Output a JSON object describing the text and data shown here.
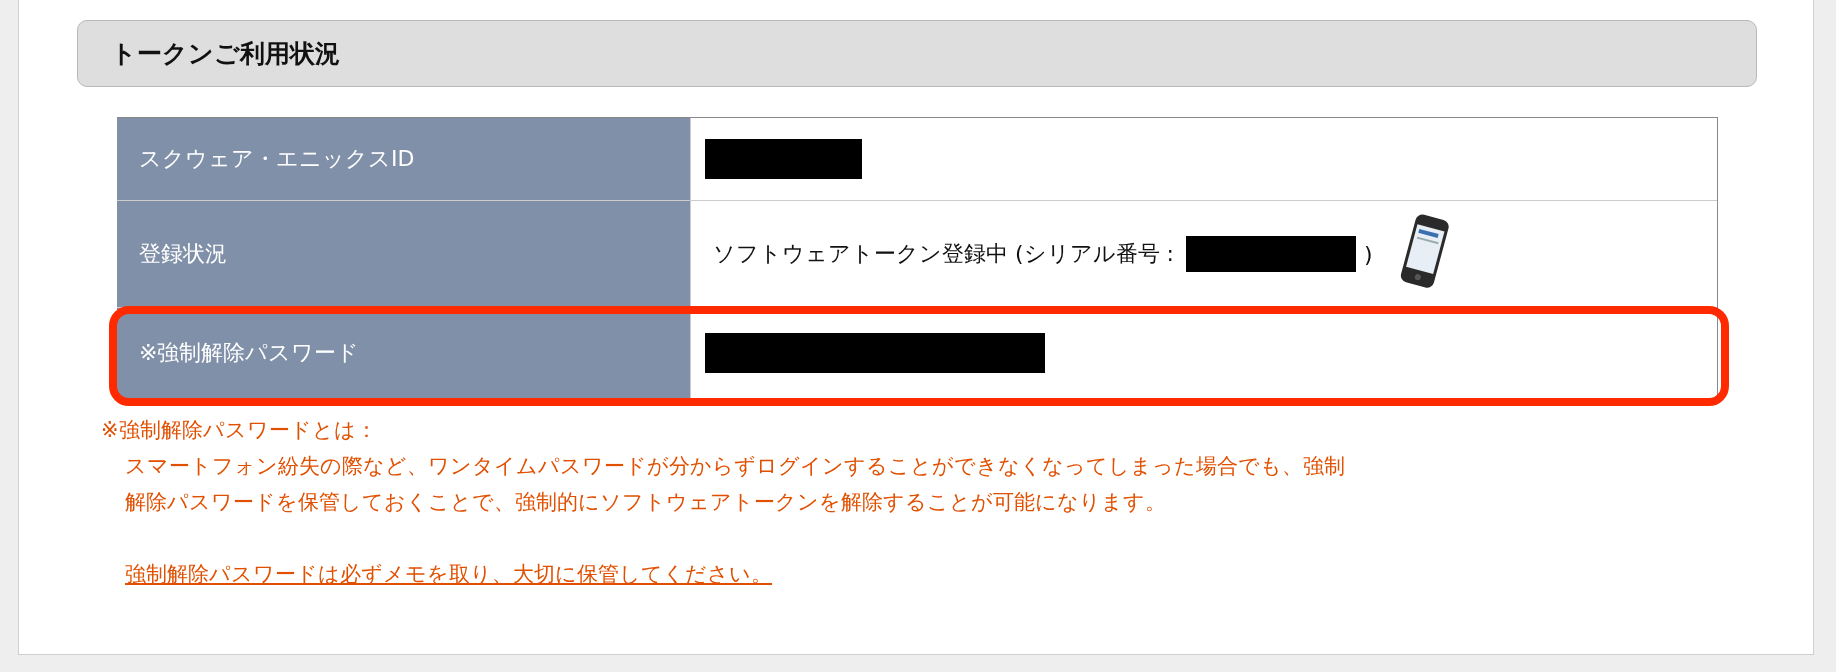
{
  "section": {
    "title": "トークンご利用状況"
  },
  "rows": [
    {
      "label": "スクウェア・エニックスID",
      "kind": "redacted",
      "highlighted": false
    },
    {
      "label": "登録状況",
      "kind": "status",
      "value_before": "ソフトウェアトークン登録中 (シリアル番号 :",
      "value_after": ")",
      "highlighted": false
    },
    {
      "label": "※強制解除パスワード",
      "kind": "redacted",
      "highlighted": true
    }
  ],
  "note": {
    "heading": "※強制解除パスワードとは：",
    "lines": [
      "スマートフォン紛失の際など、ワンタイムパスワードが分からずログインすることができなくなってしまった場合でも、強制",
      "解除パスワードを保管しておくことで、強制的にソフトウェアトークンを解除することが可能になります。"
    ],
    "link": "強制解除パスワードは必ずメモを取り、大切に保管してください。"
  }
}
